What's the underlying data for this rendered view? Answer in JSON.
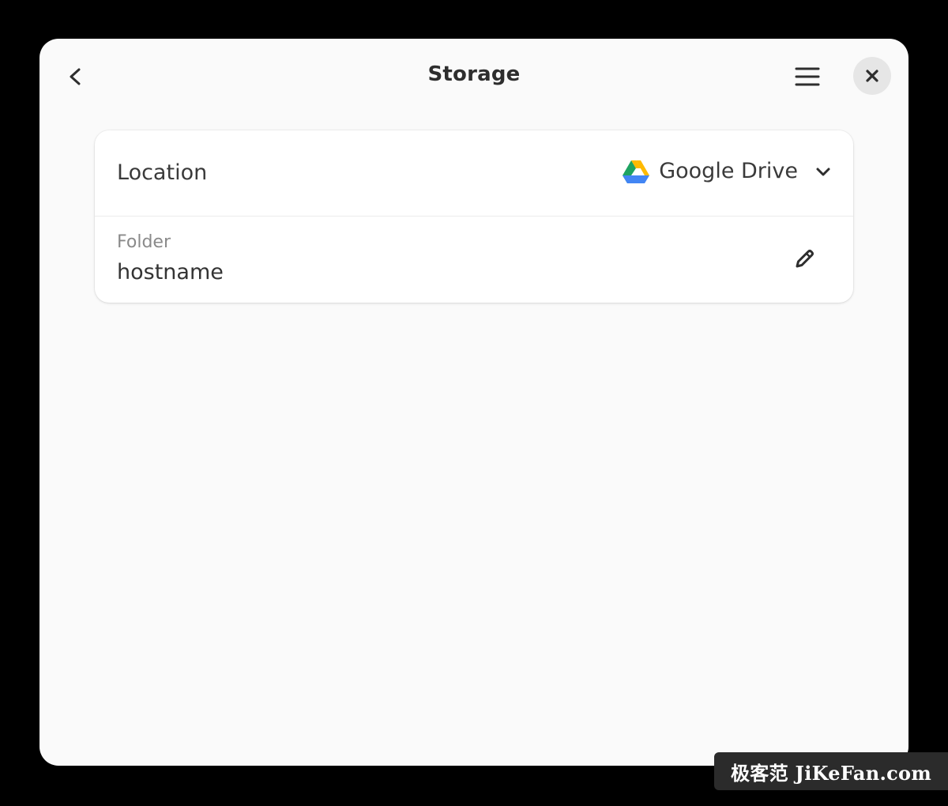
{
  "window": {
    "title": "Storage"
  },
  "header": {
    "back_icon": "chevron-left-icon",
    "menu_icon": "hamburger-menu-icon",
    "close_icon": "close-icon"
  },
  "location_row": {
    "label": "Location",
    "selected_value": "Google Drive",
    "value_icon": "google-drive-icon",
    "dropdown_icon": "chevron-down-icon"
  },
  "folder_row": {
    "caption": "Folder",
    "value": "hostname",
    "edit_icon": "pencil-icon"
  },
  "watermark": {
    "text": "极客范 JiKeFan.com"
  },
  "colors": {
    "window_background": "#fafafa",
    "card_background": "#ffffff",
    "close_button_background": "#e6e6e6",
    "screen_background": "#000000",
    "drive_green": "#1ea362",
    "drive_yellow": "#ffba00",
    "drive_blue": "#4285f4"
  }
}
